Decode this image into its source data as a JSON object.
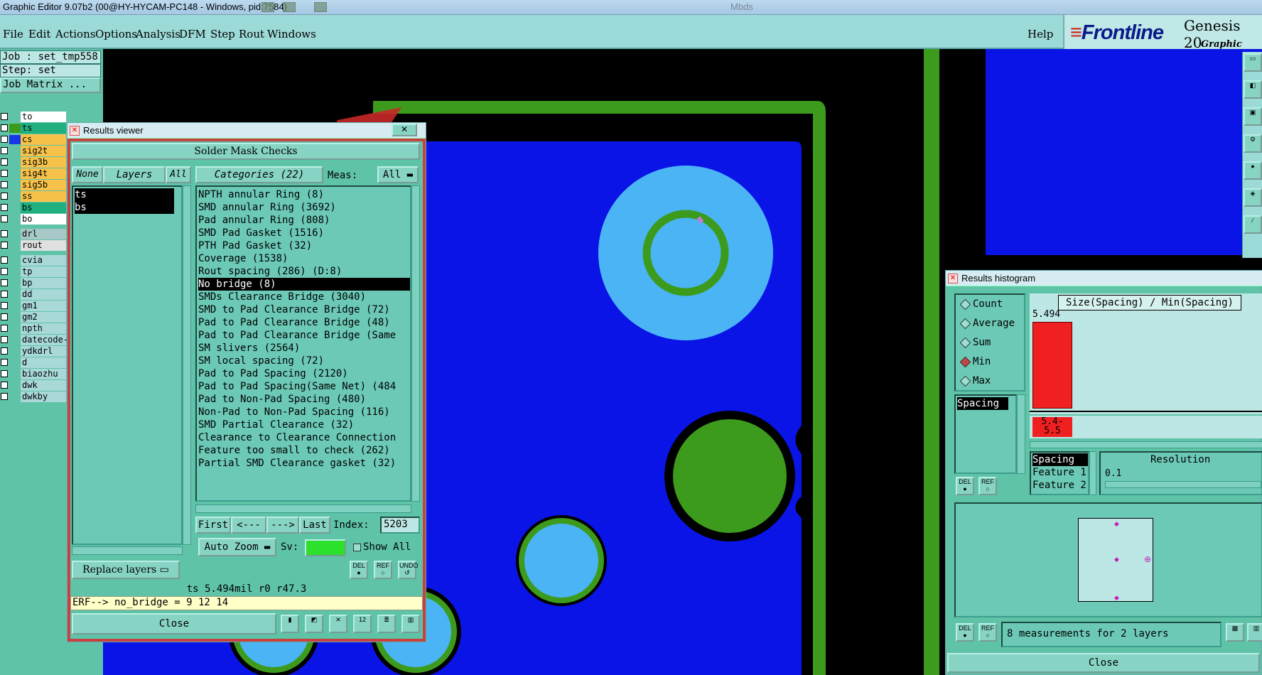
{
  "window": {
    "title": "Graphic Editor 9.07b2 (00@HY-HYCAM-PC148 - Windows, pid:7584)",
    "corner_text": "Mbds"
  },
  "menu": {
    "file": "File",
    "edit": "Edit",
    "actions": "Actions",
    "options": "Options",
    "analysis": "Analysis",
    "dfm": "DFM",
    "step": "Step",
    "rout": "Rout",
    "windows": "Windows",
    "help": "Help"
  },
  "logo": {
    "frontline": "Frontline",
    "genesis": "Genesis 20",
    "editor": "Graphic Editor"
  },
  "left": {
    "job": "Job : set_tmp558",
    "step": "Step: set",
    "job_matrix": "Job Matrix ...",
    "layers": [
      {
        "name": "to",
        "swatch": "",
        "bg": "#ffffff"
      },
      {
        "name": "ts",
        "swatch": "#3c9b1c",
        "bg": "#20b080"
      },
      {
        "name": "cs",
        "swatch": "#1838e8",
        "bg": "#f6c24a"
      },
      {
        "name": "sig2t",
        "swatch": "",
        "bg": "#f6c24a"
      },
      {
        "name": "sig3b",
        "swatch": "",
        "bg": "#f6c24a"
      },
      {
        "name": "sig4t",
        "swatch": "",
        "bg": "#f6c24a"
      },
      {
        "name": "sig5b",
        "swatch": "",
        "bg": "#f6c24a"
      },
      {
        "name": "ss",
        "swatch": "",
        "bg": "#f6c24a"
      },
      {
        "name": "bs",
        "swatch": "",
        "bg": "#20b080"
      },
      {
        "name": "bo",
        "swatch": "",
        "bg": "#ffffff"
      },
      {
        "name": "drl",
        "swatch": "",
        "bg": "#a8c8c8"
      },
      {
        "name": "rout",
        "swatch": "",
        "bg": "#e0e0e0"
      },
      {
        "name": "cvia",
        "swatch": "",
        "bg": "#a8d8d8"
      },
      {
        "name": "tp",
        "swatch": "",
        "bg": "#a8d8d8"
      },
      {
        "name": "bp",
        "swatch": "",
        "bg": "#a8d8d8"
      },
      {
        "name": "dd",
        "swatch": "",
        "bg": "#a8d8d8"
      },
      {
        "name": "gm1",
        "swatch": "",
        "bg": "#a8d8d8"
      },
      {
        "name": "gm2",
        "swatch": "",
        "bg": "#a8d8d8"
      },
      {
        "name": "npth",
        "swatch": "",
        "bg": "#a8d8d8"
      },
      {
        "name": "datecode-",
        "swatch": "",
        "bg": "#a8d8d8"
      },
      {
        "name": "ydkdrl",
        "swatch": "",
        "bg": "#a8d8d8"
      },
      {
        "name": "d",
        "swatch": "",
        "bg": "#a8d8d8"
      },
      {
        "name": "biaozhu",
        "swatch": "",
        "bg": "#a8d8d8"
      },
      {
        "name": "dwk",
        "swatch": "",
        "bg": "#a8d8d8"
      },
      {
        "name": "dwkby",
        "swatch": "",
        "bg": "#a8d8d8"
      }
    ]
  },
  "results_viewer": {
    "title": "Results viewer",
    "close_x": "✕",
    "header": "Solder Mask Checks",
    "none": "None",
    "layers": "Layers",
    "all": "All",
    "categories": "Categories (22)",
    "meas_label": "Meas:",
    "meas_value": "All",
    "layer_items": [
      "ts",
      "bs"
    ],
    "category_items": [
      "NPTH annular Ring (8)",
      "SMD annular Ring (3692)",
      "Pad annular Ring (808)",
      "SMD Pad Gasket (1516)",
      "PTH Pad Gasket (32)",
      "Coverage (1538)",
      "Rout spacing (286)        (D:8)",
      "No bridge (8)",
      "SMDs Clearance Bridge (3040)",
      "SMD to Pad Clearance Bridge (72)",
      "Pad to Pad Clearance Bridge (48)",
      "Pad to Pad Clearance Bridge (Same",
      "SM slivers (2564)",
      "SM local spacing (72)",
      "Pad to Pad Spacing (2120)",
      "Pad to Pad Spacing(Same Net) (484",
      "Pad to Non-Pad Spacing (480)",
      "Non-Pad to Non-Pad Spacing (116)",
      "SMD Partial Clearance (32)",
      "Clearance to Clearance Connection",
      "Feature too small to check (262)",
      "Partial SMD Clearance gasket (32)"
    ],
    "selected_index": 7,
    "first": "First",
    "prev": "<---",
    "next": "--->",
    "last": "Last",
    "index_label": "Index:",
    "index_value": "5203",
    "auto_zoom": "Auto Zoom",
    "sv_label": "Sv:",
    "show_all": "Show All",
    "replace_layers": "Replace layers",
    "del": "DEL",
    "ref": "REF",
    "undo": "UNDO",
    "status": "ts 5.494mil  r0  r47.3",
    "erf": "ERF--> no_bridge = 9 12 14",
    "close": "Close"
  },
  "histogram": {
    "title": "Results histogram",
    "modes": [
      "Count",
      "Average",
      "Sum",
      "Min",
      "Max"
    ],
    "selected_mode": 3,
    "list_item": "Spacing",
    "formula": "Size(Spacing) / Min(Spacing)",
    "bar_value": "5.494",
    "bar_range": "5.4-\n5.5",
    "fields": [
      "Spacing",
      "Feature 1",
      "Feature 2"
    ],
    "resolution_label": "Resolution",
    "resolution_value": "0.1",
    "del": "DEL",
    "ref": "REF",
    "measurements": "8 measurements for 2 layers",
    "close": "Close"
  },
  "colors": {
    "menubar": "#9cdad8",
    "panel": "#5fc3a8",
    "canvas": "#000000",
    "copper_blue": "#0a14e6",
    "pad_cyan": "#4ab4f4",
    "mask_green": "#3c9b1c",
    "histogram_bar": "#f02020"
  }
}
